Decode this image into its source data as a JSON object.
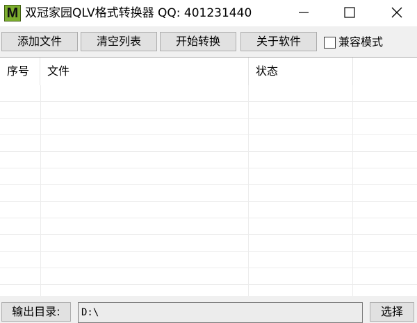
{
  "window": {
    "icon_letter": "M",
    "title": "双冠家园QLV格式转换器 QQ: 401231440",
    "icon_color": "#7dae2e"
  },
  "toolbar": {
    "add_file": "添加文件",
    "clear_list": "清空列表",
    "start_convert": "开始转换",
    "about": "关于软件",
    "compat_mode_label": "兼容模式",
    "compat_mode_checked": false
  },
  "list": {
    "columns": [
      "序号",
      "文件",
      "状态",
      ""
    ],
    "rows": []
  },
  "output": {
    "label": "输出目录:",
    "value": "D:\\",
    "choose_label": "选择"
  }
}
